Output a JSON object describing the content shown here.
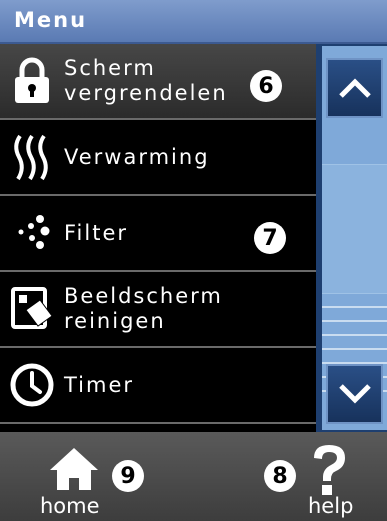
{
  "header": {
    "title": "Menu"
  },
  "menu_items": [
    {
      "label": "Scherm\nvergrendelen",
      "icon": "lock-icon"
    },
    {
      "label": "Verwarming",
      "icon": "heat-waves-icon"
    },
    {
      "label": "Filter",
      "icon": "filter-dots-icon"
    },
    {
      "label": "Beeldscherm\nreinigen",
      "icon": "screen-clean-icon"
    },
    {
      "label": "Timer",
      "icon": "clock-icon"
    }
  ],
  "badges": {
    "b6": "6",
    "b7": "7",
    "b8": "8",
    "b9": "9"
  },
  "scrollbar": {
    "up_icon": "chevron-up-icon",
    "down_icon": "chevron-down-icon"
  },
  "footer": {
    "home_label": "home",
    "help_label": "help",
    "home_icon": "home-icon",
    "help_icon": "question-mark-icon"
  },
  "colors": {
    "header_bg": "#6b89bf",
    "scroll_track": "#7fa9d9",
    "selected_row": "#3a3a3a"
  }
}
